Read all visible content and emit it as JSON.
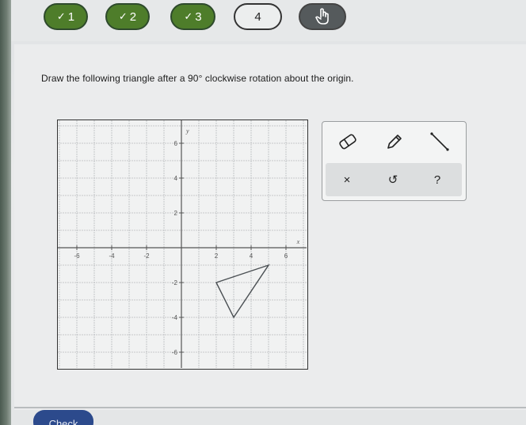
{
  "nav": {
    "questions": [
      {
        "label": "1",
        "status": "done"
      },
      {
        "label": "2",
        "status": "done"
      },
      {
        "label": "3",
        "status": "done"
      },
      {
        "label": "4",
        "status": "current"
      }
    ],
    "check_glyph": "✓",
    "next_icon": "hand-pointer-icon"
  },
  "prompt": {
    "text": "Draw the following triangle after a 90° clockwise rotation about the origin."
  },
  "graph": {
    "x_axis_label": "x",
    "y_axis_label": "y",
    "x_ticks": [
      "-6",
      "-4",
      "-2",
      "2",
      "4",
      "6"
    ],
    "y_ticks": [
      "6",
      "4",
      "2",
      "-2",
      "-4",
      "-6"
    ],
    "range": [
      -7,
      7
    ],
    "triangle": [
      [
        2,
        -2
      ],
      [
        5,
        -1
      ],
      [
        3,
        -4
      ]
    ]
  },
  "toolbox": {
    "tools": [
      "eraser-icon",
      "pencil-icon",
      "line-segment-icon"
    ],
    "clear_label": "×",
    "undo_label": "↺",
    "help_label": "?"
  },
  "footer": {
    "check_label": "Check"
  },
  "colors": {
    "done_green": "#4e7d2a",
    "check_blue": "#2c4a8c"
  }
}
